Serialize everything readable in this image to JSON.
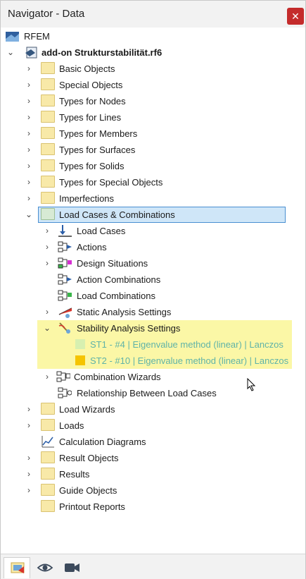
{
  "window": {
    "title": "Navigator - Data",
    "close_glyph": "✕"
  },
  "tree": {
    "root_label": "RFEM",
    "file_label": "add-on Strukturstabilität.rf6",
    "items": [
      "Basic Objects",
      "Special Objects",
      "Types for Nodes",
      "Types for Lines",
      "Types for Members",
      "Types for Surfaces",
      "Types for Solids",
      "Types for Special Objects",
      "Imperfections"
    ],
    "load_cases_combinations": "Load Cases & Combinations",
    "lcc_children": {
      "load_cases": "Load Cases",
      "actions": "Actions",
      "design_situations": "Design Situations",
      "action_combinations": "Action Combinations",
      "load_combinations": "Load Combinations",
      "static_analysis_settings": "Static Analysis Settings",
      "stability_analysis_settings": "Stability Analysis Settings",
      "st1": "ST1 - #4 | Eigenvalue method (linear) | Lanczos",
      "st2": "ST2 - #10 | Eigenvalue method (linear) | Lanczos",
      "combination_wizards": "Combination Wizards",
      "relationship": "Relationship Between Load Cases"
    },
    "after_items": {
      "load_wizards": "Load Wizards",
      "loads": "Loads",
      "calculation_diagrams": "Calculation Diagrams",
      "result_objects": "Result Objects",
      "results": "Results",
      "guide_objects": "Guide Objects",
      "printout_reports": "Printout Reports"
    }
  },
  "colors": {
    "selection": "#cfe6f8",
    "highlight": "#fbf7a6",
    "st_text": "#5fb3a8",
    "st1_square": "#d7f0b0",
    "st2_square": "#f5c400"
  },
  "bottom_tabs": [
    "data-navigator-icon",
    "eye-icon",
    "video-camera-icon"
  ]
}
